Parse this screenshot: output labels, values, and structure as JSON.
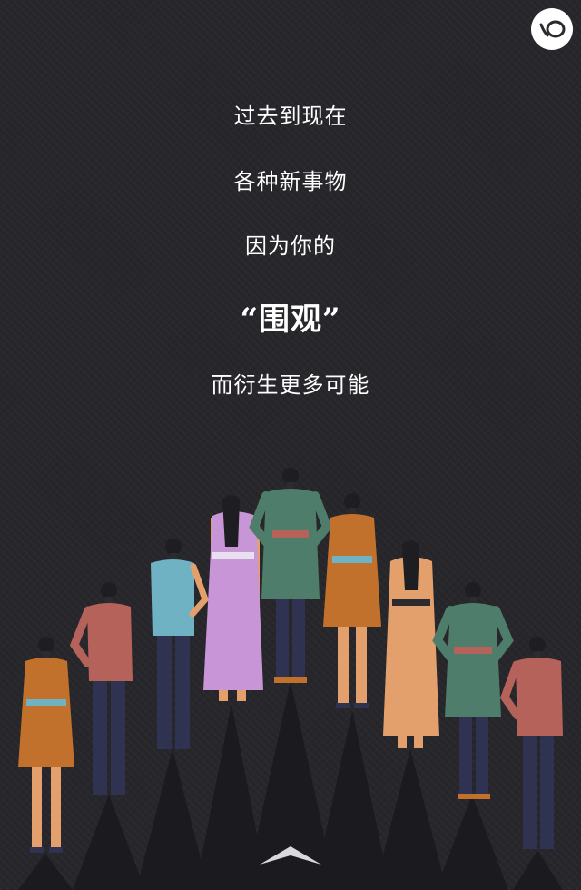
{
  "poem": {
    "line1": "过去到现在",
    "line2": "各种新事物",
    "line3": "因为你的",
    "line4": "“围观”",
    "line5": "而衍生更多可能"
  },
  "icons": {
    "music": "music-toggle-icon",
    "next": "swipe-up-arrow-icon"
  },
  "colors": {
    "background": "#27272b",
    "text": "#ffffff",
    "orange": "#c2712c",
    "coral": "#b5625b",
    "teal": "#6fb2c4",
    "lilac": "#c895d7",
    "green": "#4f7d6b",
    "peach": "#e3a06d",
    "navy": "#2f3351"
  }
}
